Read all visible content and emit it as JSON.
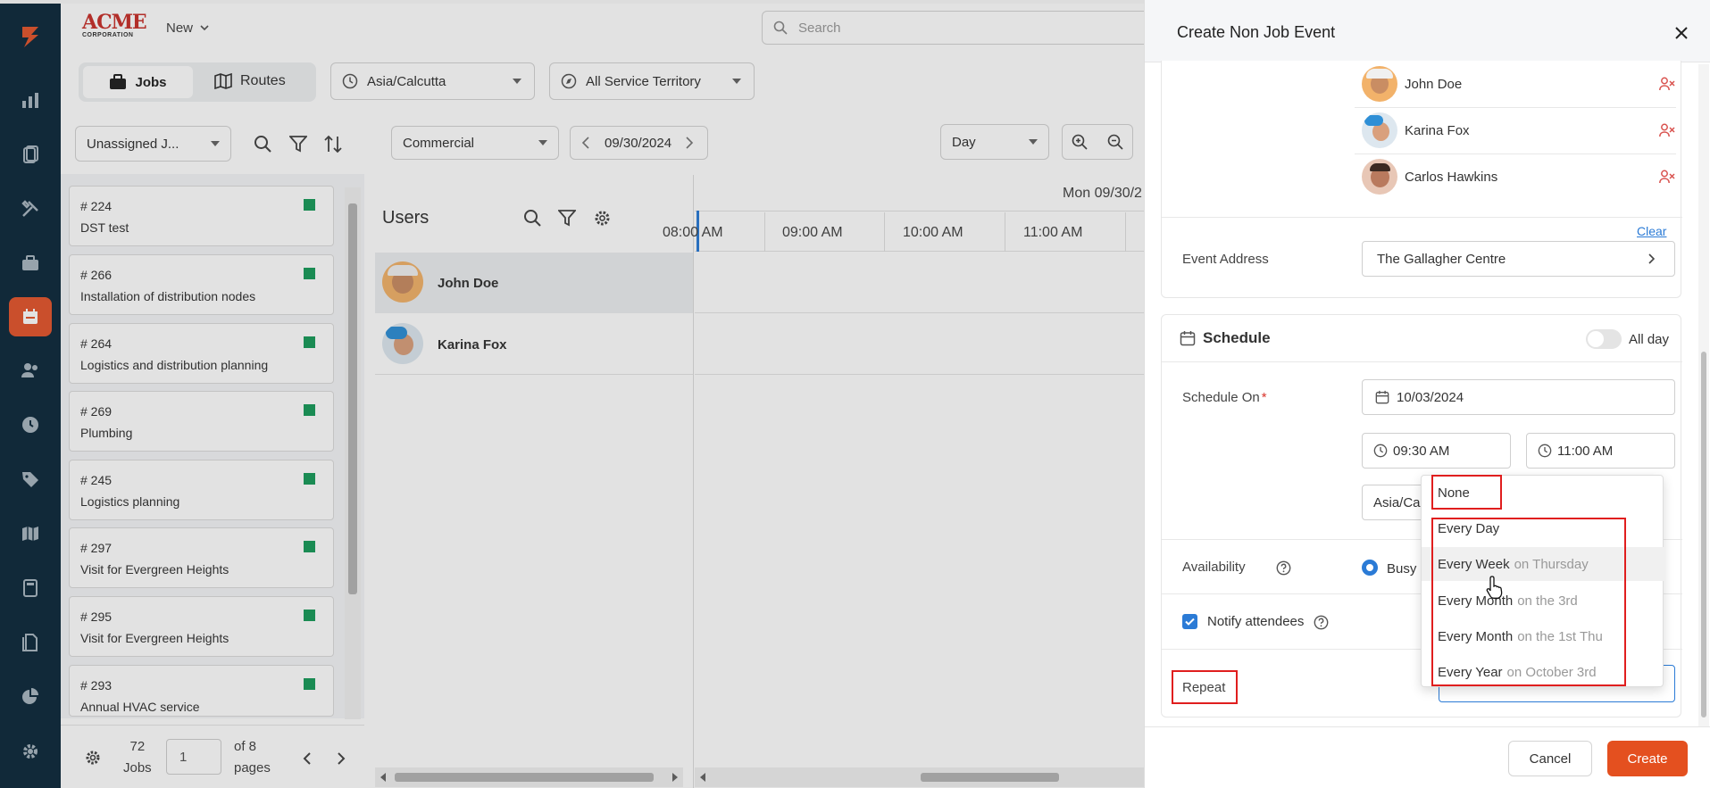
{
  "app": {
    "logo_text": "ACME",
    "logo_sub": "CORPORATION",
    "new_label": "New",
    "search_placeholder": "Search"
  },
  "toolbar": {
    "jobs_tab": "Jobs",
    "routes_tab": "Routes",
    "timezone": "Asia/Calcutta",
    "territory": "All Service Territory",
    "job_filter": "Unassigned J...",
    "category": "Commercial",
    "date": "09/30/2024",
    "view": "Day"
  },
  "jobs": [
    {
      "num": "# 224",
      "title": "DST test"
    },
    {
      "num": "# 266",
      "title": "Installation of distribution nodes"
    },
    {
      "num": "# 264",
      "title": "Logistics and distribution planning"
    },
    {
      "num": "# 269",
      "title": "Plumbing"
    },
    {
      "num": "# 245",
      "title": "Logistics planning"
    },
    {
      "num": "# 297",
      "title": "Visit for Evergreen Heights"
    },
    {
      "num": "# 295",
      "title": "Visit for Evergreen Heights"
    },
    {
      "num": "# 293",
      "title": "Annual HVAC service"
    }
  ],
  "pagination": {
    "count": "72",
    "unit": "Jobs",
    "page": "1",
    "of_label": "of 8",
    "pages_label": "pages"
  },
  "scheduler": {
    "users_title": "Users",
    "day_label": "Mon 09/30/2",
    "users": [
      "John Doe",
      "Karina Fox"
    ],
    "hours": [
      "08:00 AM",
      "09:00 AM",
      "10:00 AM",
      "11:00 AM"
    ]
  },
  "drawer": {
    "title": "Create Non Job Event",
    "attendees": [
      "John Doe",
      "Karina Fox",
      "Carlos Hawkins"
    ],
    "clear_label": "Clear",
    "event_address_label": "Event Address",
    "event_address": "The Gallagher Centre",
    "schedule_title": "Schedule",
    "all_day_label": "All day",
    "schedule_on_label": "Schedule On",
    "required_mark": "*",
    "schedule_date": "10/03/2024",
    "start_time": "09:30 AM",
    "end_time": "11:00 AM",
    "timezone": "Asia/Calcu",
    "availability_label": "Availability",
    "busy_label": "Busy",
    "notify_label": "Notify attendees",
    "repeat_label": "Repeat",
    "cancel_label": "Cancel",
    "create_label": "Create"
  },
  "repeat_options": [
    {
      "main": "None",
      "sub": ""
    },
    {
      "main": "Every Day",
      "sub": ""
    },
    {
      "main": "Every Week",
      "sub": "on Thursday"
    },
    {
      "main": "Every Month",
      "sub": "on the 3rd"
    },
    {
      "main": "Every Month",
      "sub": "on the 1st Thu"
    },
    {
      "main": "Every Year",
      "sub": "on October 3rd"
    }
  ],
  "colors": {
    "rail": "#0f2b3d",
    "accent": "#e4572e",
    "job_status": "#1a9c5b",
    "link": "#2b7bd6",
    "annotation": "#e01e1e"
  }
}
